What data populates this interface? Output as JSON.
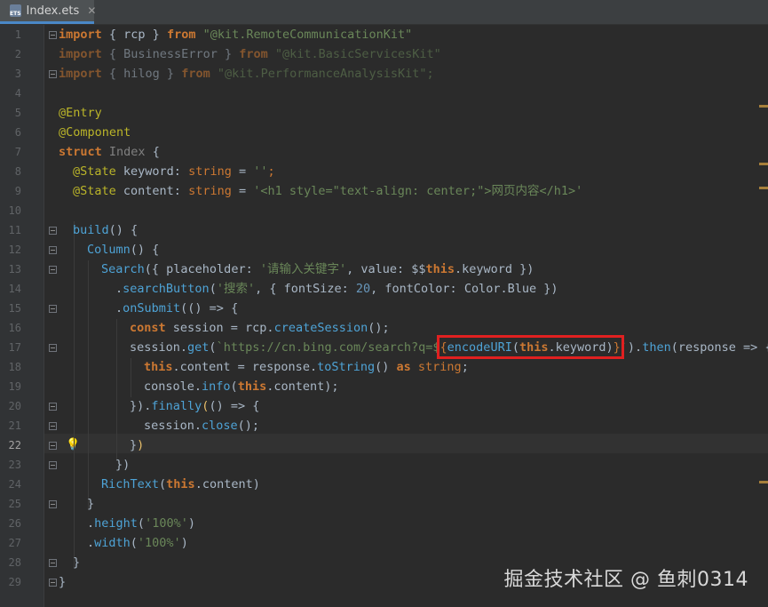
{
  "tab": {
    "icon": "ets-file-icon",
    "label": "Index.ets",
    "close": "✕"
  },
  "line_numbers": [
    "1",
    "2",
    "3",
    "4",
    "5",
    "6",
    "7",
    "8",
    "9",
    "10",
    "11",
    "12",
    "13",
    "14",
    "15",
    "16",
    "17",
    "18",
    "19",
    "20",
    "21",
    "22",
    "23",
    "24",
    "25",
    "26",
    "27",
    "28",
    "29"
  ],
  "current_line": "22",
  "code": {
    "l1": {
      "a": "import",
      "b": " { rcp } ",
      "c": "from",
      "d": " \"@kit.RemoteCommunicationKit\""
    },
    "l2": {
      "a": "import",
      "b": " { BusinessError } ",
      "c": "from",
      "d": " \"@kit.BasicServicesKit\""
    },
    "l3": {
      "a": "import",
      "b": " { hilog } ",
      "c": "from",
      "d": " \"@kit.PerformanceAnalysisKit\";"
    },
    "l5": "@Entry",
    "l6": "@Component",
    "l7": {
      "a": "struct",
      "b": " Index",
      "c": " {"
    },
    "l8": {
      "a": "@State",
      "b": " keyword: ",
      "c": "string",
      "d": " = ",
      "e": "''",
      "f": ";"
    },
    "l9": {
      "a": "@State",
      "b": " content: ",
      "c": "string",
      "d": " = ",
      "e": "'<h1 style=\"text-align: center;\">网页内容</h1>'"
    },
    "l11": {
      "a": "build",
      "b": "() {"
    },
    "l12": {
      "a": "Column",
      "b": "() {"
    },
    "l13": {
      "a": "Search",
      "b": "({ placeholder: ",
      "c": "'请输入关键字'",
      "d": ", value: $$",
      "e": "this",
      "f": ".keyword })"
    },
    "l14": {
      "a": ".",
      "b": "searchButton",
      "c": "(",
      "d": "'搜索'",
      "e": ", { fontSize: ",
      "f": "20",
      "g": ", fontColor: Color.Blue })"
    },
    "l15": {
      "a": ".",
      "b": "onSubmit",
      "c": "(() => {"
    },
    "l16": {
      "a": "const",
      "b": " session = rcp.",
      "c": "createSession",
      "d": "();"
    },
    "l17": {
      "a": "session.",
      "b": "get",
      "c": "(",
      "d": "`https://cn.bing.com/search?q=$",
      "e": "{",
      "f": "encodeURI",
      "g": "(",
      "h": "this",
      "i": ".keyword)",
      "j": "}",
      "k": "`",
      "l": ").",
      "m": "then",
      "n": "(response => {"
    },
    "l18": {
      "a": "this",
      "b": ".content = response.",
      "c": "toString",
      "d": "() ",
      "e": "as",
      "f": " ",
      "g": "string",
      "h": ";"
    },
    "l19": {
      "a": "console.",
      "b": "info",
      "c": "(",
      "d": "this",
      "e": ".content);"
    },
    "l20": {
      "a": "}).",
      "b": "finally",
      "c": "(",
      "d": "() => {"
    },
    "l21": {
      "a": "session.",
      "b": "close",
      "c": "();"
    },
    "l22": {
      "a": "}",
      "b": ")"
    },
    "l23": "})",
    "l24": {
      "a": "RichText",
      "b": "(",
      "c": "this",
      "d": ".content)"
    },
    "l25": "}",
    "l26": {
      "a": ".",
      "b": "height",
      "c": "(",
      "d": "'100%'",
      "e": ")"
    },
    "l27": {
      "a": ".",
      "b": "width",
      "c": "(",
      "d": "'100%'",
      "e": ")"
    },
    "l28": "}",
    "l29": "}"
  },
  "watermark": "掘金技术社区 @ 鱼刺0314",
  "colors": {
    "keyword": "#cc7832",
    "string": "#6a8759",
    "number": "#6897bb",
    "annotation": "#bbb529",
    "highlight_box": "#e02020"
  }
}
